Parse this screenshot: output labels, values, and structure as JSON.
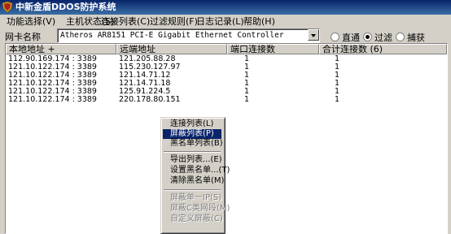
{
  "window": {
    "title": "中新金盾DDOS防护系统"
  },
  "menu": [
    "功能选择(V)",
    "主机状态(S)",
    "连接列表(C)",
    "过滤规则(F)",
    "日志记录(L)",
    "帮助(H)"
  ],
  "toolbar": {
    "nic_label": "网卡名称",
    "nic_value": "Atheros AR8151 PCI-E Gigabit Ethernet Controller",
    "modes": [
      {
        "label": "直通",
        "selected": false
      },
      {
        "label": "过滤",
        "selected": true
      },
      {
        "label": "捕获",
        "selected": false
      }
    ]
  },
  "table": {
    "columns": [
      "本地地址 +",
      "远端地址",
      "端口连接数",
      "合计连接数 (6)"
    ],
    "rows": [
      [
        "112.90.169.174 : 3389",
        "121.205.88.28",
        "1",
        "1"
      ],
      [
        "121.10.122.174 : 3389",
        "115.230.127.97",
        "1",
        "1"
      ],
      [
        "121.10.122.174 : 3389",
        "121.14.71.12",
        "1",
        "1"
      ],
      [
        "121.10.122.174 : 3389",
        "121.14.71.18",
        "1",
        "1"
      ],
      [
        "121.10.122.174 : 3389",
        "125.91.224.5",
        "1",
        "1"
      ],
      [
        "121.10.122.174 : 3389",
        "220.178.80.151",
        "1",
        "1"
      ]
    ]
  },
  "context_menu": {
    "items": [
      {
        "label": "连接列表(L)",
        "state": "normal"
      },
      {
        "label": "屏蔽列表(P)",
        "state": "highlighted"
      },
      {
        "label": "黑名单列表(B)",
        "state": "normal"
      },
      {
        "label": "导出列表...(E)",
        "state": "normal"
      },
      {
        "label": "设置黑名单...(T)",
        "state": "normal"
      },
      {
        "label": "清除黑名单(M)",
        "state": "normal"
      },
      {
        "label": "屏蔽单一IP(S)",
        "state": "disabled"
      },
      {
        "label": "屏蔽C类网段(M)",
        "state": "disabled"
      },
      {
        "label": "自定义屏蔽(C)",
        "state": "disabled"
      }
    ]
  }
}
